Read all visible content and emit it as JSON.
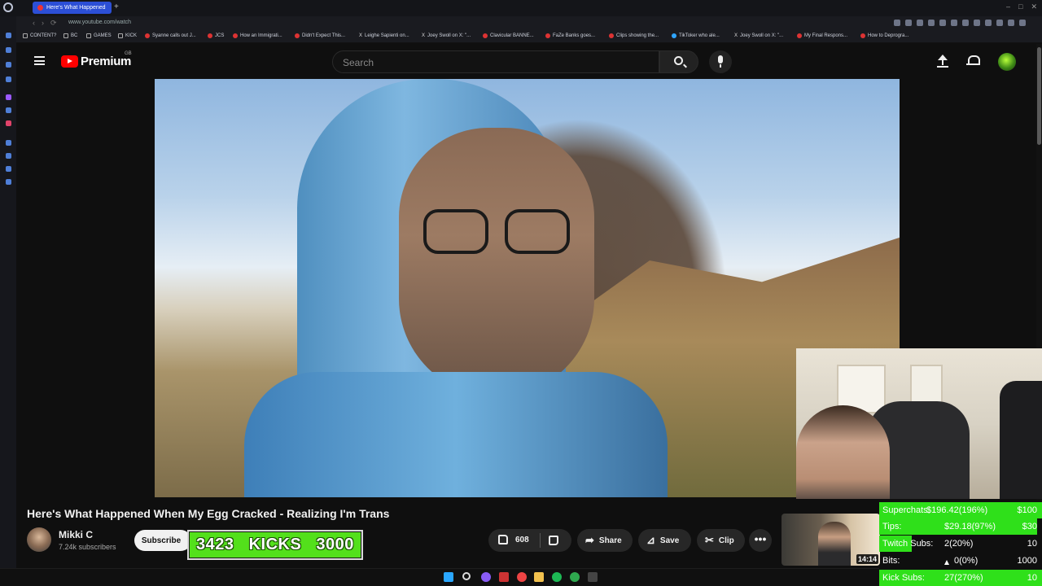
{
  "browser": {
    "tab_title": "Here's What Happened",
    "url": "www.youtube.com/watch",
    "bookmarks": [
      "CONTENT?",
      "BC",
      "GAMES",
      "KICK",
      "Syanne calls out J...",
      "JCS",
      "How an Immigrati...",
      "Didn't Expect This...",
      "Leighe Sapienti on...",
      "Joey Swoll on X: \"...",
      "Clavicular BANNE...",
      "FaZe Banks goes...",
      "Clips showing the...",
      "TikToker who ale...",
      "Joey Swoll on X: \"...",
      "My Final Respons...",
      "How to Deprogra..."
    ]
  },
  "header": {
    "logo_text": "Premium",
    "region": "GB",
    "search_placeholder": "Search"
  },
  "video": {
    "title": "Here's What Happened When My Egg Cracked - Realizing I'm Trans",
    "channel_name": "Mikki C",
    "subscribers": "7.24k subscribers",
    "subscribe_label": "Subscribe",
    "likes": "608",
    "share_label": "Share",
    "save_label": "Save",
    "clip_label": "Clip",
    "more_label": "•••"
  },
  "kicks_widget": {
    "current": "3423",
    "label": "KICKS",
    "goal": "3000",
    "progress": 1.0,
    "color": "#53e01b"
  },
  "up_next": {
    "duration": "14:14"
  },
  "stats": [
    {
      "label": "Superchats:",
      "value": "$196.42(196%)",
      "goal": "$100",
      "progress": 1.0
    },
    {
      "label": "Tips:",
      "value": "$29.18(97%)",
      "goal": "$30",
      "progress": 0.97
    },
    {
      "label": "Twitch Subs:",
      "value": "2(20%)",
      "goal": "10",
      "progress": 0.2
    },
    {
      "label": "Bits:",
      "value": "0(0%)",
      "goal": "1000",
      "progress": 0.0
    },
    {
      "label": "Kick Subs:",
      "value": "27(270%)",
      "goal": "10",
      "progress": 1.0
    }
  ],
  "colors": {
    "youtube_red": "#ff0000",
    "stats_green": "#2fe01a",
    "tab_active": "#2c4fd6"
  }
}
